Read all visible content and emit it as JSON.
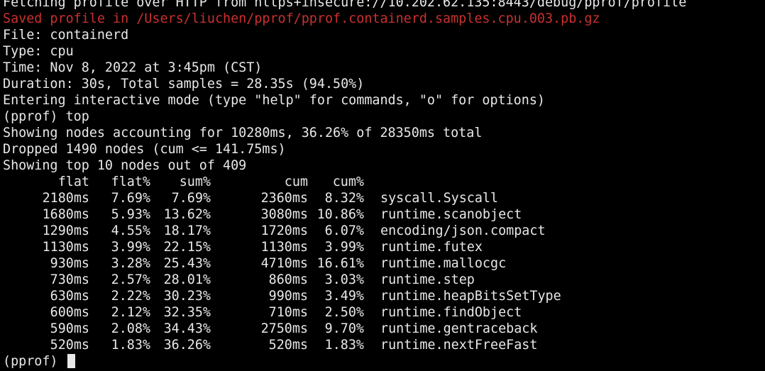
{
  "header_lines": [
    {
      "text": "Fetching profile over HTTP from https+insecure://10.202.62.135:8443/debug/pprof/profile",
      "style": "normal"
    },
    {
      "text": "Saved profile in /Users/liuchen/pprof/pprof.containerd.samples.cpu.003.pb.gz",
      "style": "error"
    },
    {
      "text": "File: containerd",
      "style": "normal"
    },
    {
      "text": "Type: cpu",
      "style": "normal"
    },
    {
      "text": "Time: Nov 8, 2022 at 3:45pm (CST)",
      "style": "normal"
    },
    {
      "text": "Duration: 30s, Total samples = 28.35s (94.50%)",
      "style": "normal"
    },
    {
      "text": "Entering interactive mode (type \"help\" for commands, \"o\" for options)",
      "style": "normal"
    },
    {
      "text": "(pprof) top",
      "style": "normal"
    },
    {
      "text": "Showing nodes accounting for 10280ms, 36.26% of 28350ms total",
      "style": "normal"
    },
    {
      "text": "Dropped 1490 nodes (cum <= 141.75ms)",
      "style": "normal"
    },
    {
      "text": "Showing top 10 nodes out of 409",
      "style": "normal"
    }
  ],
  "table": {
    "headers": {
      "flat": "flat",
      "flat_pct": "flat%",
      "sum_pct": "sum%",
      "cum": "cum",
      "cum_pct": "cum%"
    },
    "rows": [
      {
        "flat": "2180ms",
        "flat_pct": "7.69%",
        "sum_pct": "7.69%",
        "cum": "2360ms",
        "cum_pct": "8.32%",
        "name": "syscall.Syscall"
      },
      {
        "flat": "1680ms",
        "flat_pct": "5.93%",
        "sum_pct": "13.62%",
        "cum": "3080ms",
        "cum_pct": "10.86%",
        "name": "runtime.scanobject"
      },
      {
        "flat": "1290ms",
        "flat_pct": "4.55%",
        "sum_pct": "18.17%",
        "cum": "1720ms",
        "cum_pct": "6.07%",
        "name": "encoding/json.compact"
      },
      {
        "flat": "1130ms",
        "flat_pct": "3.99%",
        "sum_pct": "22.15%",
        "cum": "1130ms",
        "cum_pct": "3.99%",
        "name": "runtime.futex"
      },
      {
        "flat": "930ms",
        "flat_pct": "3.28%",
        "sum_pct": "25.43%",
        "cum": "4710ms",
        "cum_pct": "16.61%",
        "name": "runtime.mallocgc"
      },
      {
        "flat": "730ms",
        "flat_pct": "2.57%",
        "sum_pct": "28.01%",
        "cum": "860ms",
        "cum_pct": "3.03%",
        "name": "runtime.step"
      },
      {
        "flat": "630ms",
        "flat_pct": "2.22%",
        "sum_pct": "30.23%",
        "cum": "990ms",
        "cum_pct": "3.49%",
        "name": "runtime.heapBitsSetType"
      },
      {
        "flat": "600ms",
        "flat_pct": "2.12%",
        "sum_pct": "32.35%",
        "cum": "710ms",
        "cum_pct": "2.50%",
        "name": "runtime.findObject"
      },
      {
        "flat": "590ms",
        "flat_pct": "2.08%",
        "sum_pct": "34.43%",
        "cum": "2750ms",
        "cum_pct": "9.70%",
        "name": "runtime.gentraceback"
      },
      {
        "flat": "520ms",
        "flat_pct": "1.83%",
        "sum_pct": "36.26%",
        "cum": "520ms",
        "cum_pct": "1.83%",
        "name": "runtime.nextFreeFast"
      }
    ]
  },
  "prompt": "(pprof)",
  "colors": {
    "background": "#000000",
    "foreground": "#e8e8e8",
    "error": "#c9312f"
  }
}
